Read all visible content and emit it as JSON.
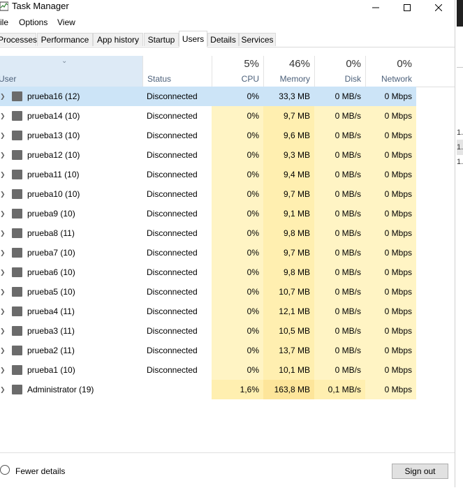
{
  "window": {
    "title": "Task Manager"
  },
  "menu": [
    "ile",
    "Options",
    "View"
  ],
  "tabs": [
    {
      "label": "Processes"
    },
    {
      "label": "Performance"
    },
    {
      "label": "App history"
    },
    {
      "label": "Startup"
    },
    {
      "label": "Users",
      "active": true
    },
    {
      "label": "Details"
    },
    {
      "label": "Services"
    }
  ],
  "columns": {
    "user": "User",
    "status": "Status",
    "cpu": {
      "pct": "5%",
      "label": "CPU"
    },
    "memory": {
      "pct": "46%",
      "label": "Memory"
    },
    "disk": {
      "pct": "0%",
      "label": "Disk"
    },
    "network": {
      "pct": "0%",
      "label": "Network"
    }
  },
  "users": [
    {
      "name": "prueba16 (12)",
      "status": "Disconnected",
      "cpu": "0%",
      "memory": "33,3 MB",
      "disk": "0 MB/s",
      "network": "0 Mbps"
    },
    {
      "name": "prueba14 (10)",
      "status": "Disconnected",
      "cpu": "0%",
      "memory": "9,7 MB",
      "disk": "0 MB/s",
      "network": "0 Mbps"
    },
    {
      "name": "prueba13 (10)",
      "status": "Disconnected",
      "cpu": "0%",
      "memory": "9,6 MB",
      "disk": "0 MB/s",
      "network": "0 Mbps"
    },
    {
      "name": "prueba12 (10)",
      "status": "Disconnected",
      "cpu": "0%",
      "memory": "9,3 MB",
      "disk": "0 MB/s",
      "network": "0 Mbps"
    },
    {
      "name": "prueba11 (10)",
      "status": "Disconnected",
      "cpu": "0%",
      "memory": "9,4 MB",
      "disk": "0 MB/s",
      "network": "0 Mbps"
    },
    {
      "name": "prueba10 (10)",
      "status": "Disconnected",
      "cpu": "0%",
      "memory": "9,7 MB",
      "disk": "0 MB/s",
      "network": "0 Mbps"
    },
    {
      "name": "prueba9 (10)",
      "status": "Disconnected",
      "cpu": "0%",
      "memory": "9,1 MB",
      "disk": "0 MB/s",
      "network": "0 Mbps"
    },
    {
      "name": "prueba8 (11)",
      "status": "Disconnected",
      "cpu": "0%",
      "memory": "9,8 MB",
      "disk": "0 MB/s",
      "network": "0 Mbps"
    },
    {
      "name": "prueba7 (10)",
      "status": "Disconnected",
      "cpu": "0%",
      "memory": "9,7 MB",
      "disk": "0 MB/s",
      "network": "0 Mbps"
    },
    {
      "name": "prueba6 (10)",
      "status": "Disconnected",
      "cpu": "0%",
      "memory": "9,8 MB",
      "disk": "0 MB/s",
      "network": "0 Mbps"
    },
    {
      "name": "prueba5 (10)",
      "status": "Disconnected",
      "cpu": "0%",
      "memory": "10,7 MB",
      "disk": "0 MB/s",
      "network": "0 Mbps"
    },
    {
      "name": "prueba4 (11)",
      "status": "Disconnected",
      "cpu": "0%",
      "memory": "12,1 MB",
      "disk": "0 MB/s",
      "network": "0 Mbps"
    },
    {
      "name": "prueba3 (11)",
      "status": "Disconnected",
      "cpu": "0%",
      "memory": "10,5 MB",
      "disk": "0 MB/s",
      "network": "0 Mbps"
    },
    {
      "name": "prueba2 (11)",
      "status": "Disconnected",
      "cpu": "0%",
      "memory": "13,7 MB",
      "disk": "0 MB/s",
      "network": "0 Mbps"
    },
    {
      "name": "prueba1 (10)",
      "status": "Disconnected",
      "cpu": "0%",
      "memory": "10,1 MB",
      "disk": "0 MB/s",
      "network": "0 Mbps"
    },
    {
      "name": "Administrator (19)",
      "status": "",
      "cpu": "1,6%",
      "memory": "163,8 MB",
      "disk": "0,1 MB/s",
      "network": "0 Mbps"
    }
  ],
  "footer": {
    "fewer_details": "Fewer details",
    "sign_out": "Sign out"
  },
  "side_fragments": [
    "1.",
    "1.",
    "1."
  ],
  "colors": {
    "heat_light": "#fff4c4",
    "heat_mid": "#ffefb0",
    "heat_strong": "#fde59a",
    "selection": "#cce4f7",
    "header_selected": "#ddeaf6"
  }
}
